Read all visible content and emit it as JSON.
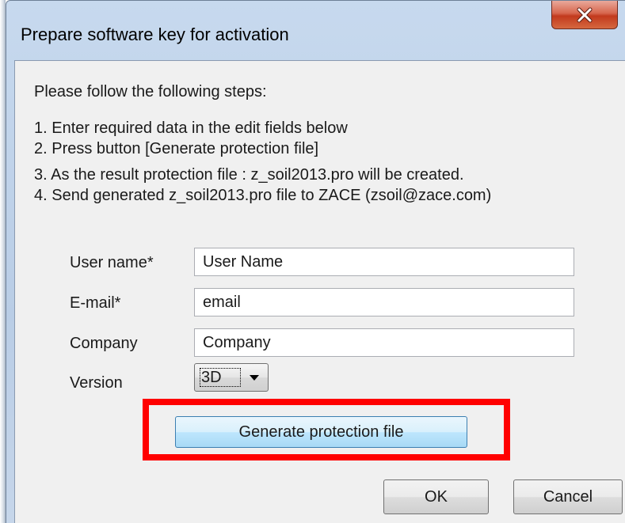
{
  "window": {
    "title": "Prepare software key for activation",
    "close_glyph": "close-icon"
  },
  "instructions": {
    "heading": "Please follow the following steps:",
    "step1": "1. Enter required data in the edit fields below",
    "step2": "2. Press button [Generate protection file]",
    "step3": "3. As the result protection file : z_soil2013.pro will be created.",
    "step4": "4. Send generated z_soil2013.pro file to ZACE (zsoil@zace.com)"
  },
  "form": {
    "user_name": {
      "label": "User name*",
      "value": "User Name"
    },
    "email": {
      "label": "E-mail*",
      "value": "email"
    },
    "company": {
      "label": "Company",
      "value": "Company"
    },
    "version": {
      "label": "Version",
      "value": "3D"
    }
  },
  "buttons": {
    "generate": "Generate protection file",
    "ok": "OK",
    "cancel": "Cancel"
  },
  "colors": {
    "highlight": "#ff0000",
    "close_button": "#c2391d",
    "generate_button": "#bee6fd"
  }
}
